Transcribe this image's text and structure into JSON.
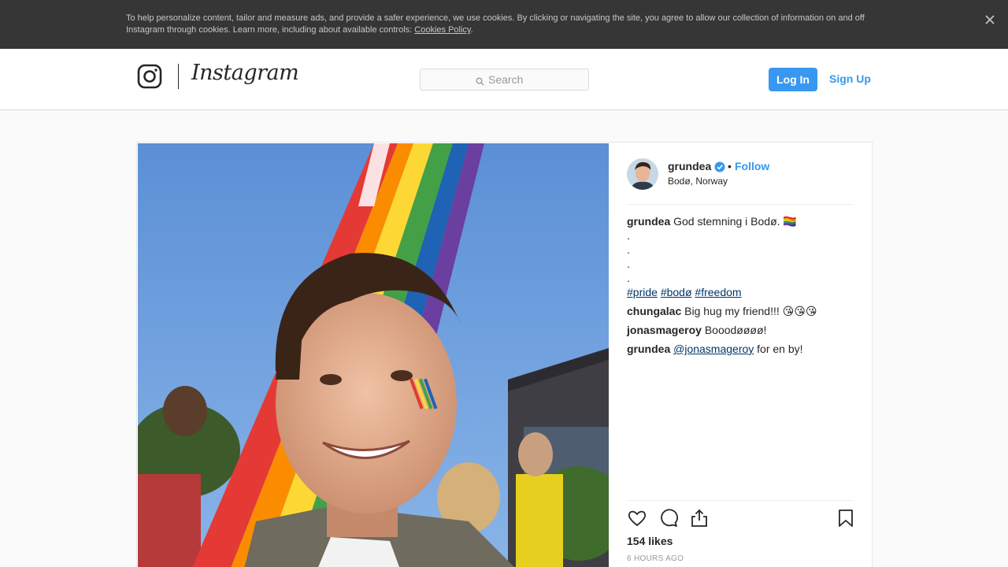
{
  "cookie_banner": {
    "text": "To help personalize content, tailor and measure ads, and provide a safer experience, we use cookies. By clicking or navigating the site, you agree to allow our collection of information on and off Instagram through cookies. Learn more, including about available controls: ",
    "link": "Cookies Policy",
    "link_suffix": ".",
    "close_icon": "close-icon"
  },
  "header": {
    "logo_text": "Instagram",
    "logo_icon": "instagram-camera-icon",
    "search": {
      "placeholder": "Search",
      "icon": "search-icon"
    },
    "login_label": "Log In",
    "signup_label": "Sign Up",
    "accent_color": "#3897f0"
  },
  "post": {
    "author": {
      "username": "grundea",
      "verified": true,
      "location": "Bodø, Norway",
      "follow_label": "Follow",
      "separator": "•"
    },
    "caption": {
      "username": "grundea",
      "text": "God stemning i Bodø. 🏳️‍🌈",
      "dots": [
        ".",
        ".",
        ".",
        "."
      ],
      "hashtags": [
        "#pride",
        "#bodø",
        "#freedom"
      ]
    },
    "comments": [
      {
        "username": "chungalac",
        "text": "Big hug my friend!!! 😘😘😘"
      },
      {
        "username": "jonasmageroy",
        "text": "Booodøøøø!"
      },
      {
        "username": "grundea",
        "mention": "@jonasmageroy",
        "text": " for en by!"
      }
    ],
    "actions": {
      "like_icon": "heart-icon",
      "comment_icon": "comment-bubble-icon",
      "share_icon": "share-icon",
      "save_icon": "bookmark-icon"
    },
    "likes": "154 likes",
    "timestamp": "6 HOURS AGO"
  }
}
